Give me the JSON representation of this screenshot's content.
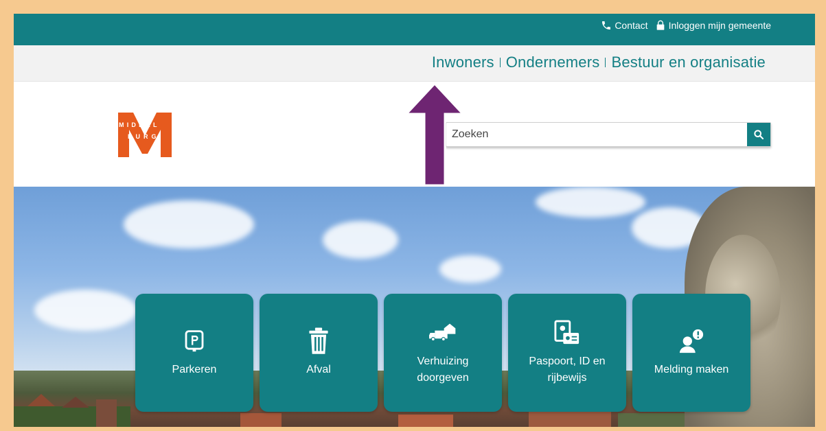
{
  "topbar": {
    "contact_label": "Contact",
    "login_label": "Inloggen mijn gemeente"
  },
  "nav": {
    "items": [
      {
        "label": "Inwoners"
      },
      {
        "label": "Ondernemers"
      },
      {
        "label": "Bestuur en organisatie"
      }
    ]
  },
  "logo": {
    "line1": "MIDDEL",
    "line2": "BURG"
  },
  "search": {
    "placeholder": "Zoeken"
  },
  "tiles": [
    {
      "label": "Parkeren",
      "icon": "parking-icon"
    },
    {
      "label": "Afval",
      "icon": "trash-icon"
    },
    {
      "label": "Verhuizing doorgeven",
      "icon": "moving-truck-icon"
    },
    {
      "label": "Paspoort, ID en rijbewijs",
      "icon": "id-card-icon"
    },
    {
      "label": "Melding maken",
      "icon": "report-person-icon"
    }
  ],
  "colors": {
    "brand_teal": "#137f84",
    "logo_orange": "#e65a1e",
    "arrow_purple": "#6e2572",
    "frame_border": "#f6c98f"
  }
}
